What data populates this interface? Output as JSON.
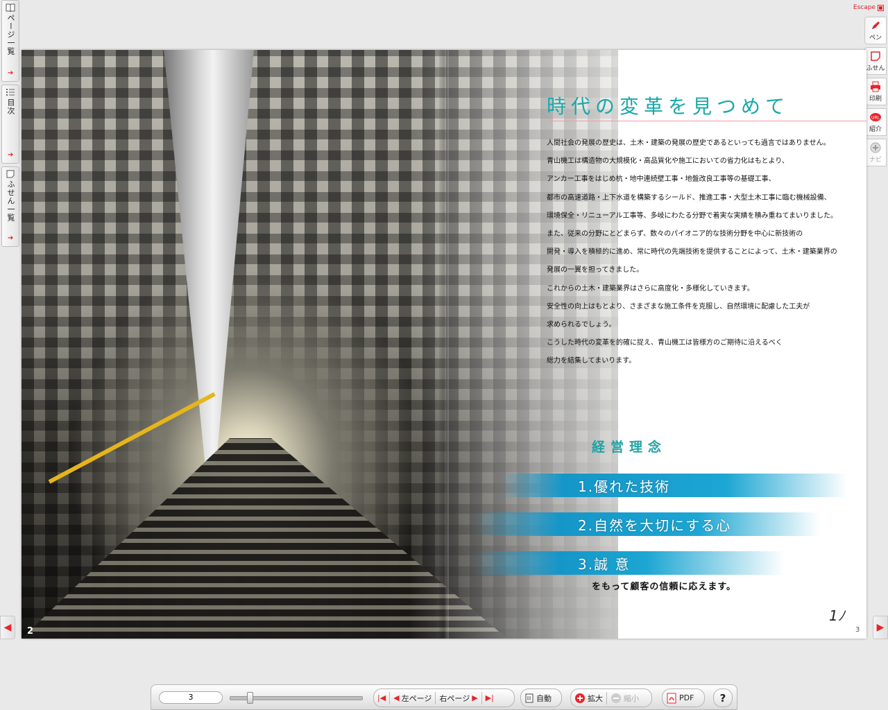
{
  "left_tabs": [
    {
      "label": "ページ一覧",
      "icon": "book-icon"
    },
    {
      "label": "目次",
      "icon": "list-icon"
    },
    {
      "label": "ふせん一覧",
      "icon": "note-icon"
    }
  ],
  "right_tools": {
    "escape_label": "Escape",
    "items": [
      {
        "label": "ペン",
        "icon": "pen-icon",
        "enabled": true
      },
      {
        "label": "ふせん",
        "icon": "sticky-note-icon",
        "enabled": true
      },
      {
        "label": "印刷",
        "icon": "print-icon",
        "enabled": true
      },
      {
        "label": "紹介",
        "icon": "url-icon",
        "enabled": true
      },
      {
        "label": "ナビ",
        "icon": "navi-icon",
        "enabled": false
      }
    ]
  },
  "page": {
    "heading": "時代の変革を見つめて",
    "body_lines": [
      "人間社会の発展の歴史は、土木・建築の発展の歴史であるといっても過言ではありません。",
      "青山機工は構造物の大規模化・高品質化や施工においての省力化はもとより、",
      "アンカー工事をはじめ杭・地中連続壁工事・地盤改良工事等の基礎工事、",
      "都市の高速道路・上下水道を構築するシールド、推進工事・大型土木工事に臨む機械設備、",
      "環境保全・リニューアル工事等、多岐にわたる分野で着実な実績を積み重ねてまいりました。",
      "また、従来の分野にとどまらず、数々のパイオニア的な技術分野を中心に新技術の",
      "開発・導入を積極的に進め、常に時代の先端技術を提供することによって、土木・建築業界の",
      "発展の一翼を担ってきました。",
      "これからの土木・建築業界はさらに高度化・多様化していきます。",
      "安全性の向上はもとより、さまざまな施工条件を克服し、自然環境に配慮した工夫が",
      "求められるでしょう。",
      "こうした時代の変革を的確に捉え、青山機工は皆様方のご期待に沿えるべく",
      "総力を結集してまいります。"
    ],
    "philosophy_title": "経営理念",
    "philosophy_items": [
      "1.優れた技術",
      "2.自然を大切にする心",
      "3.誠 意"
    ],
    "philosophy_sub": "をもって顧客の信頼に応えます。",
    "left_page_number": "2",
    "right_page_number": "3",
    "signature": "1ﾉ"
  },
  "bottom_bar": {
    "page_value": "3",
    "slider_position": 0.13,
    "first_icon": "first-page-icon",
    "left_page": "左ページ",
    "right_page": "右ページ",
    "last_icon": "last-page-icon",
    "auto": "自動",
    "zoom_in": "拡大",
    "zoom_out": "縮小",
    "pdf": "PDF",
    "help": "?"
  },
  "colors": {
    "accent_red": "#e8242b",
    "heading_teal": "#1aa7a8",
    "band_blue": "#1ca6d3"
  }
}
